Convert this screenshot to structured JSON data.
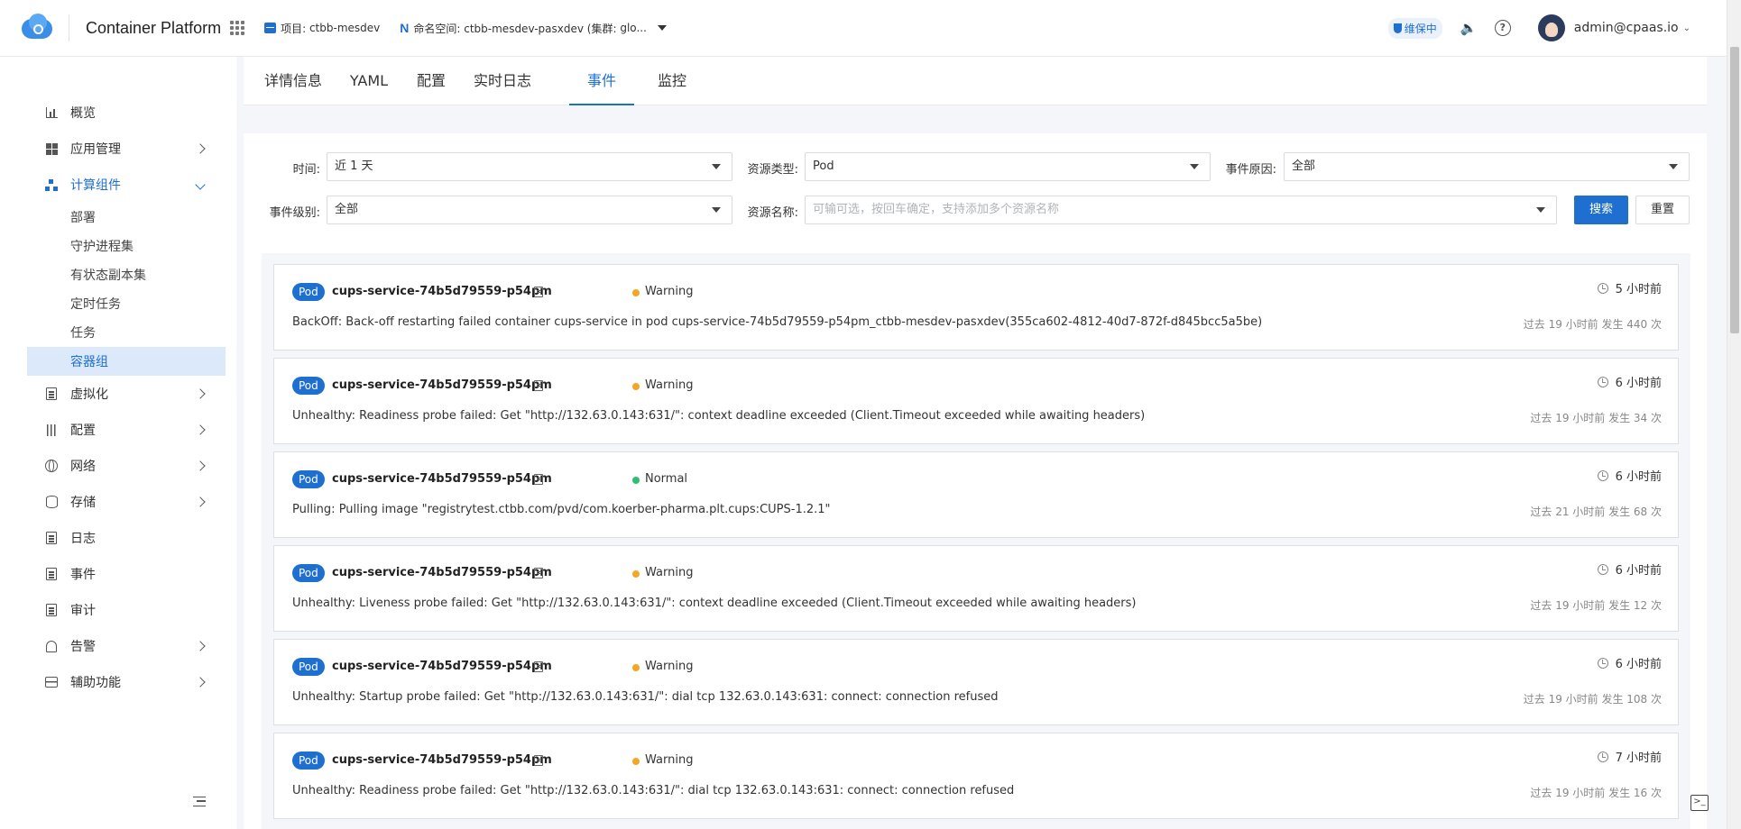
{
  "header": {
    "product": "Container Platform",
    "project_label": "项目:",
    "project_value": "ctbb-mesdev",
    "namespace_label": "命名空间:",
    "namespace_value": "ctbb-mesdev-pasxdev (集群:",
    "cluster_value": "glo...",
    "maintenance": "维保中",
    "user": "admin@cpaas.io",
    "help_icon_glyph": "?"
  },
  "sidebar": {
    "items": [
      {
        "label": "概览",
        "icon": "bar-chart-icon"
      },
      {
        "label": "应用管理",
        "icon": "app-blocks-icon"
      },
      {
        "label": "计算组件",
        "icon": "tree-icon"
      },
      {
        "label": "虚拟化",
        "icon": "vm-icon"
      },
      {
        "label": "配置",
        "icon": "sliders-icon"
      },
      {
        "label": "网络",
        "icon": "globe-icon"
      },
      {
        "label": "存储",
        "icon": "database-icon"
      },
      {
        "label": "日志",
        "icon": "log-icon"
      },
      {
        "label": "事件",
        "icon": "event-icon"
      },
      {
        "label": "审计",
        "icon": "audit-icon"
      },
      {
        "label": "告警",
        "icon": "bell-icon"
      },
      {
        "label": "辅助功能",
        "icon": "toolbox-icon"
      }
    ],
    "sub_items": [
      "部署",
      "守护进程集",
      "有状态副本集",
      "定时任务",
      "任务",
      "容器组"
    ]
  },
  "tabs": [
    "详情信息",
    "YAML",
    "配置",
    "实时日志",
    "事件",
    "监控"
  ],
  "filters": {
    "time_label": "时间:",
    "time_value": "近 1 天",
    "resource_type_label": "资源类型:",
    "resource_type_value": "Pod",
    "reason_label": "事件原因:",
    "reason_value": "全部",
    "level_label": "事件级别:",
    "level_value": "全部",
    "resource_name_label": "资源名称:",
    "resource_name_placeholder": "可输可选，按回车确定，支持添加多个资源名称",
    "search_button": "搜索",
    "reset_button": "重置"
  },
  "colors": {
    "accent": "#1f6fd1",
    "warning": "#f5a623",
    "normal": "#2fbf71"
  },
  "events": [
    {
      "kind": "Pod",
      "name": "cups-service-74b5d79559-p54pm",
      "level": "Warning",
      "time": "5 小时前",
      "message": "BackOff: Back-off restarting failed container cups-service in pod cups-service-74b5d79559-p54pm_ctbb-mesdev-pasxdev(355ca602-4812-40d7-872f-d845bcc5a5be)",
      "count": "过去 19 小时前 发生 440 次"
    },
    {
      "kind": "Pod",
      "name": "cups-service-74b5d79559-p54pm",
      "level": "Warning",
      "time": "6 小时前",
      "message": "Unhealthy: Readiness probe failed: Get \"http://132.63.0.143:631/\": context deadline exceeded (Client.Timeout exceeded while awaiting headers)",
      "count": "过去 19 小时前 发生 34 次"
    },
    {
      "kind": "Pod",
      "name": "cups-service-74b5d79559-p54pm",
      "level": "Normal",
      "time": "6 小时前",
      "message": "Pulling: Pulling image \"registrytest.ctbb.com/pvd/com.koerber-pharma.plt.cups:CUPS-1.2.1\"",
      "count": "过去 21 小时前 发生 68 次"
    },
    {
      "kind": "Pod",
      "name": "cups-service-74b5d79559-p54pm",
      "level": "Warning",
      "time": "6 小时前",
      "message": "Unhealthy: Liveness probe failed: Get \"http://132.63.0.143:631/\": context deadline exceeded (Client.Timeout exceeded while awaiting headers)",
      "count": "过去 19 小时前 发生 12 次"
    },
    {
      "kind": "Pod",
      "name": "cups-service-74b5d79559-p54pm",
      "level": "Warning",
      "time": "6 小时前",
      "message": "Unhealthy: Startup probe failed: Get \"http://132.63.0.143:631/\": dial tcp 132.63.0.143:631: connect: connection refused",
      "count": "过去 19 小时前 发生 108 次"
    },
    {
      "kind": "Pod",
      "name": "cups-service-74b5d79559-p54pm",
      "level": "Warning",
      "time": "7 小时前",
      "message": "Unhealthy: Readiness probe failed: Get \"http://132.63.0.143:631/\": dial tcp 132.63.0.143:631: connect: connection refused",
      "count": "过去 19 小时前 发生 16 次"
    }
  ]
}
